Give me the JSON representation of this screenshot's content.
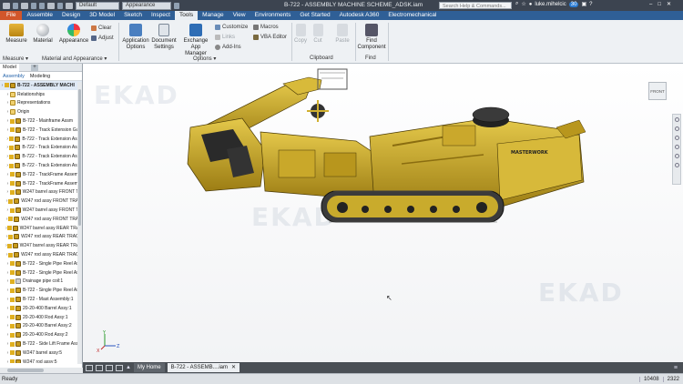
{
  "title_bar": {
    "workspace_select": "Default",
    "appearance_select": "Appearance",
    "document_title": "B-722 - ASSEMBLY MACHINE SCHEME_ADSK.iam",
    "search_placeholder": "Search Help & Commands...",
    "user": "luke.mihelcic",
    "notifications": "30"
  },
  "tabs": [
    "File",
    "Assemble",
    "Design",
    "3D Model",
    "Sketch",
    "Inspect",
    "Tools",
    "Manage",
    "View",
    "Environments",
    "Get Started",
    "Autodesk A360",
    "Electromechanical"
  ],
  "active_tab": "Tools",
  "ribbon": {
    "measure": {
      "label": "Measure"
    },
    "material": {
      "label": "Material"
    },
    "appearance": {
      "label": "Appearance"
    },
    "clear": "Clear",
    "adjust": "Adjust",
    "application_options": "Application Options",
    "document_settings": "Document Settings",
    "exchange": "Exchange App Manager",
    "customize": "Customize",
    "links": "Links",
    "addins": "Add-Ins",
    "macros": "Macros",
    "vba_editor": "VBA Editor",
    "copy": "Copy",
    "cut": "Cut",
    "paste": "Paste",
    "find_component": "Find Component",
    "panels": {
      "measure": "Measure ▾",
      "material_appearance": "Material and Appearance ▾",
      "options": "Options ▾",
      "clipboard": "Clipboard",
      "find": "Find"
    }
  },
  "browser": {
    "tab_model": "Model",
    "tab_plus": "+",
    "sub_assembly": "Assembly",
    "sub_modeling": "Modeling",
    "items": [
      {
        "label": "B-722 - ASSEMBLY MACHI",
        "type": "root"
      },
      {
        "label": "Relationships",
        "type": "folder"
      },
      {
        "label": "Representations",
        "type": "folder"
      },
      {
        "label": "Origin",
        "type": "folder"
      },
      {
        "label": "B-722 - Mainframe Assm",
        "type": "asm"
      },
      {
        "label": "B-722 - Track Extension Gus",
        "type": "asm"
      },
      {
        "label": "B-722 - Track Extension Asse",
        "type": "asm"
      },
      {
        "label": "B-722 - Track Extension Asse",
        "type": "asm"
      },
      {
        "label": "B-722 - Track Extension Asse",
        "type": "asm"
      },
      {
        "label": "B-722 - Track Extension Asse",
        "type": "asm"
      },
      {
        "label": "B-722 - TrackFrame Assemb",
        "type": "asm"
      },
      {
        "label": "B-722 - TrackFrame Assemb",
        "type": "asm"
      },
      {
        "label": "W247 barrel assy FRONT TR",
        "type": "asm"
      },
      {
        "label": "W247 rod assy FRONT TRAC",
        "type": "asm"
      },
      {
        "label": "W247 barrel assy FRONT TR",
        "type": "asm"
      },
      {
        "label": "W247 rod assy FRONT TRAC",
        "type": "asm"
      },
      {
        "label": "W247 barrel assy REAR TRAC",
        "type": "asm"
      },
      {
        "label": "W247 rod assy REAR TRACK",
        "type": "asm"
      },
      {
        "label": "W247 barrel assy REAR TRAC",
        "type": "asm"
      },
      {
        "label": "W247 rod assy REAR TRACK",
        "type": "asm"
      },
      {
        "label": "B-722 - Single Pipe Reel Ass",
        "type": "asm"
      },
      {
        "label": "B-722 - Single Pipe Reel Ass",
        "type": "asm"
      },
      {
        "label": "Drainage pipe coil:1",
        "type": "prt"
      },
      {
        "label": "B-722 - Single Pipe Reel Ass",
        "type": "asm"
      },
      {
        "label": "B-722 - Mast Assembly:1",
        "type": "asm"
      },
      {
        "label": "20-20-400 Barrel Assy:1",
        "type": "asm"
      },
      {
        "label": "20-20-400 Rod Assy:1",
        "type": "asm"
      },
      {
        "label": "20-20-400 Barrel Assy:2",
        "type": "asm"
      },
      {
        "label": "20-20-400 Rod Assy:2",
        "type": "asm"
      },
      {
        "label": "B-722 - Side Lift Frame Ass",
        "type": "asm"
      },
      {
        "label": "W247 barrel assy:5",
        "type": "asm"
      },
      {
        "label": "W247 rod assy:5",
        "type": "asm"
      }
    ]
  },
  "viewport": {
    "watermark": "EKAD",
    "viewcube": "FRONT",
    "machine_brand": "MASTERWORK",
    "triad": {
      "x": "X",
      "y": "Y",
      "z": "Z"
    }
  },
  "doc_tabs": {
    "home": "My Home",
    "active": "B-722 - ASSEMB....iam"
  },
  "status": {
    "left": "Ready",
    "coords": [
      "10408",
      "2322"
    ]
  },
  "colors": {
    "file_tab": "#d2562a",
    "ribbon_tabs": "#2f5f96",
    "machine": "#c9a82a"
  }
}
